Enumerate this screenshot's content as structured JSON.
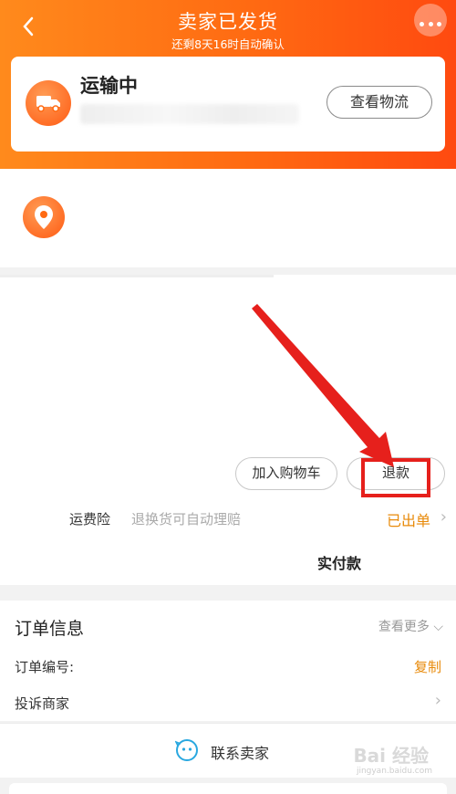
{
  "header": {
    "back_icon": "chevron-left-icon",
    "title": "卖家已发货",
    "subtitle": "还剩8天16时自动确认",
    "more_icon": "more-dots-icon"
  },
  "status_card": {
    "icon": "truck-icon",
    "title": "运输中",
    "track_button": "查看物流"
  },
  "address": {
    "icon": "location-pin-icon"
  },
  "product": {
    "add_cart_button": "加入购物车",
    "refund_button": "退款",
    "shipping_insurance": {
      "label": "运费险",
      "description": "退换货可自动理赔",
      "status": "已出单"
    },
    "paid_label": "实付款"
  },
  "order_info": {
    "title": "订单信息",
    "view_more": "查看更多",
    "order_number_label": "订单编号:",
    "copy_button": "复制",
    "complain_label": "投诉商家"
  },
  "contact": {
    "icon": "chat-face-icon",
    "label": "联系卖家"
  },
  "watermark": {
    "brand": "Bai 经验",
    "url": "jingyan.baidu.com"
  },
  "colors": {
    "header_gradient_start": "#ff8a1c",
    "header_gradient_end": "#ff4a10",
    "accent_orange": "#e88a0a",
    "annotation_red": "#e6201c"
  }
}
